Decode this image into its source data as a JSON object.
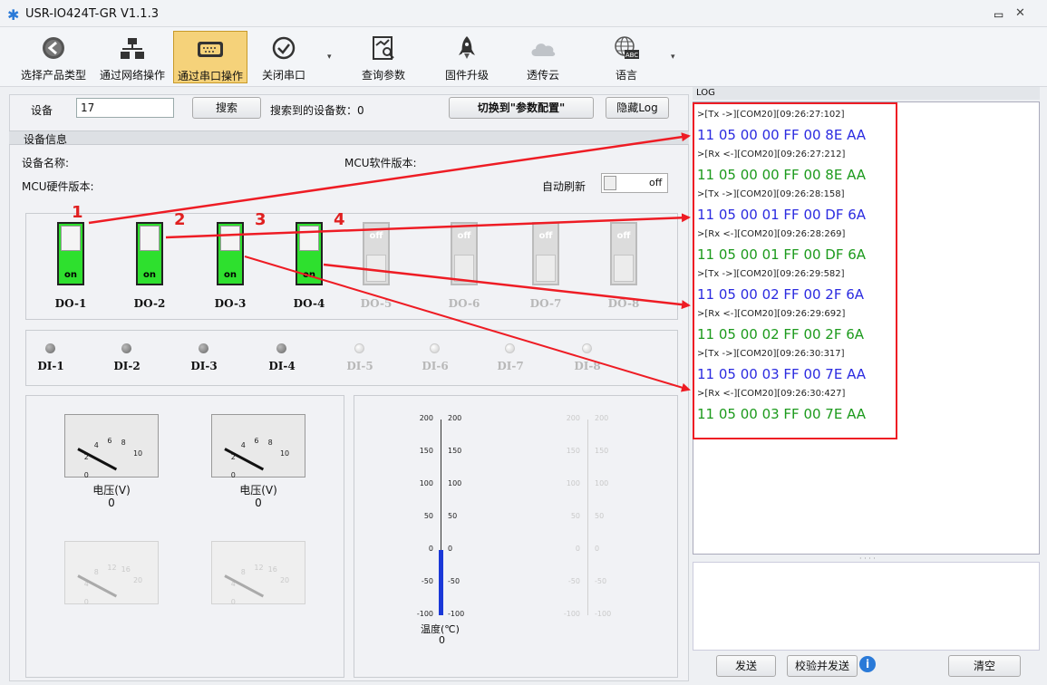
{
  "window": {
    "title": "USR-IO424T-GR V1.1.3"
  },
  "toolbar": {
    "select_product": "选择产品类型",
    "network_op": "通过网络操作",
    "serial_op": "通过串口操作",
    "close_port": "关闭串口",
    "query_params": "查询参数",
    "firmware": "固件升级",
    "cloud": "透传云",
    "language": "语言"
  },
  "device": {
    "label": "设备",
    "value": "17",
    "search_button": "搜索",
    "found_label": "搜索到的设备数：0",
    "switch_button": "切换到\"参数配置\"",
    "hide_log_button": "隐藏Log"
  },
  "info": {
    "section_title": "设备信息",
    "device_name": "设备名称:",
    "mcu_soft": "MCU软件版本:",
    "mcu_hard": "MCU硬件版本:",
    "auto_refresh": "自动刷新",
    "auto_refresh_state": "off"
  },
  "outputs": [
    {
      "label": "DO-1",
      "state": "on",
      "marker": "1"
    },
    {
      "label": "DO-2",
      "state": "on",
      "marker": "2"
    },
    {
      "label": "DO-3",
      "state": "on",
      "marker": "3"
    },
    {
      "label": "DO-4",
      "state": "on",
      "marker": "4"
    },
    {
      "label": "DO-5",
      "state": "off"
    },
    {
      "label": "DO-6",
      "state": "off"
    },
    {
      "label": "DO-7",
      "state": "off"
    },
    {
      "label": "DO-8",
      "state": "off"
    }
  ],
  "inputs": [
    "DI-1",
    "DI-2",
    "DI-3",
    "DI-4",
    "DI-5",
    "DI-6",
    "DI-7",
    "DI-8"
  ],
  "meters": {
    "scale_small": [
      "0",
      "2",
      "4",
      "6",
      "8",
      "10"
    ],
    "scale_large": [
      "0",
      "4",
      "8",
      "12",
      "16",
      "20"
    ],
    "m1": {
      "caption": "电压(V)",
      "value": "0"
    },
    "m2": {
      "caption": "电压(V)",
      "value": "0"
    }
  },
  "thermo": {
    "ticks": [
      "200",
      "150",
      "100",
      "50",
      "0",
      "-50",
      "-100"
    ],
    "caption": "温度(℃)",
    "value": "0"
  },
  "log": {
    "header": "LOG",
    "lines": [
      {
        "t": "meta",
        "text": ">[Tx ->][COM20][09:26:27:102]"
      },
      {
        "t": "tx",
        "text": "11 05 00 00 FF 00 8E AA"
      },
      {
        "t": "meta",
        "text": ">[Rx <-][COM20][09:26:27:212]"
      },
      {
        "t": "rx",
        "text": "11 05 00 00 FF 00 8E AA"
      },
      {
        "t": "meta",
        "text": ">[Tx ->][COM20][09:26:28:158]"
      },
      {
        "t": "tx",
        "text": "11 05 00 01 FF 00 DF 6A"
      },
      {
        "t": "meta",
        "text": ">[Rx <-][COM20][09:26:28:269]"
      },
      {
        "t": "rx",
        "text": "11 05 00 01 FF 00 DF 6A"
      },
      {
        "t": "meta",
        "text": ">[Tx ->][COM20][09:26:29:582]"
      },
      {
        "t": "tx",
        "text": "11 05 00 02 FF 00 2F 6A"
      },
      {
        "t": "meta",
        "text": ">[Rx <-][COM20][09:26:29:692]"
      },
      {
        "t": "rx",
        "text": "11 05 00 02 FF 00 2F 6A"
      },
      {
        "t": "meta",
        "text": ">[Tx ->][COM20][09:26:30:317]"
      },
      {
        "t": "tx",
        "text": "11 05 00 03 FF 00 7E AA"
      },
      {
        "t": "meta",
        "text": ">[Rx <-][COM20][09:26:30:427]"
      },
      {
        "t": "rx",
        "text": "11 05 00 03 FF 00 7E AA"
      }
    ],
    "send_button": "发送",
    "check_send_button": "校验并发送",
    "clear_button": "清空"
  },
  "colors": {
    "tx": "#2b2be0",
    "rx": "#1c9a1c",
    "annotation": "#ee1c24",
    "on": "#2ee02e"
  }
}
